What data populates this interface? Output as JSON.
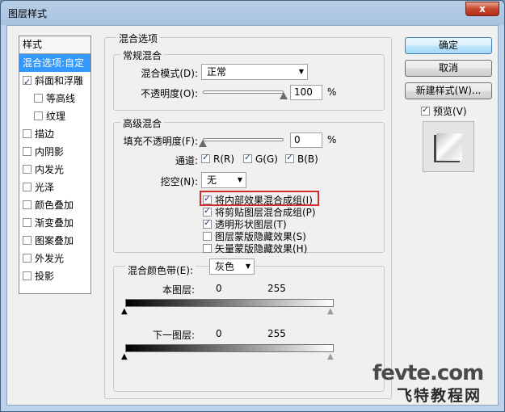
{
  "window": {
    "title": "图层样式",
    "close_glyph": "x"
  },
  "style_list": {
    "header": "样式",
    "items": [
      {
        "label": "混合选项:自定",
        "selected": true,
        "checkbox": false,
        "checked": false,
        "indent": false
      },
      {
        "label": "斜面和浮雕",
        "selected": false,
        "checkbox": true,
        "checked": true,
        "indent": false
      },
      {
        "label": "等高线",
        "selected": false,
        "checkbox": true,
        "checked": false,
        "indent": true
      },
      {
        "label": "纹理",
        "selected": false,
        "checkbox": true,
        "checked": false,
        "indent": true
      },
      {
        "label": "描边",
        "selected": false,
        "checkbox": true,
        "checked": false,
        "indent": false
      },
      {
        "label": "内阴影",
        "selected": false,
        "checkbox": true,
        "checked": false,
        "indent": false
      },
      {
        "label": "内发光",
        "selected": false,
        "checkbox": true,
        "checked": false,
        "indent": false
      },
      {
        "label": "光泽",
        "selected": false,
        "checkbox": true,
        "checked": false,
        "indent": false
      },
      {
        "label": "颜色叠加",
        "selected": false,
        "checkbox": true,
        "checked": false,
        "indent": false
      },
      {
        "label": "渐变叠加",
        "selected": false,
        "checkbox": true,
        "checked": false,
        "indent": false
      },
      {
        "label": "图案叠加",
        "selected": false,
        "checkbox": true,
        "checked": false,
        "indent": false
      },
      {
        "label": "外发光",
        "selected": false,
        "checkbox": true,
        "checked": false,
        "indent": false
      },
      {
        "label": "投影",
        "selected": false,
        "checkbox": true,
        "checked": false,
        "indent": false
      }
    ]
  },
  "blending": {
    "title": "混合选项",
    "general": {
      "title": "常规混合",
      "mode_label": "混合模式(D):",
      "mode_value": "正常",
      "opacity_label": "不透明度(O):",
      "opacity_value": "100",
      "opacity_unit": "%",
      "opacity_level": 1.0
    },
    "advanced": {
      "title": "高级混合",
      "fill_label": "填充不透明度(F):",
      "fill_value": "0",
      "fill_unit": "%",
      "fill_level": 0.0,
      "channels_label": "通道:",
      "channels": [
        {
          "label": "R(R)",
          "checked": true
        },
        {
          "label": "G(G)",
          "checked": true
        },
        {
          "label": "B(B)",
          "checked": true
        }
      ],
      "knockout_label": "挖空(N):",
      "knockout_value": "无",
      "options": [
        {
          "label": "将内部效果混合成组(I)",
          "checked": true,
          "highlighted": true
        },
        {
          "label": "将剪贴图层混合成组(P)",
          "checked": true,
          "highlighted": false
        },
        {
          "label": "透明形状图层(T)",
          "checked": true,
          "highlighted": false
        },
        {
          "label": "图层蒙版隐藏效果(S)",
          "checked": false,
          "highlighted": false
        },
        {
          "label": "矢量蒙版隐藏效果(H)",
          "checked": false,
          "highlighted": false
        }
      ]
    },
    "blend_if": {
      "label": "混合颜色带(E):",
      "value": "灰色",
      "this_layer_label": "本图层:",
      "this_layer_min": "0",
      "this_layer_max": "255",
      "underlying_label": "下一图层:",
      "underlying_min": "0",
      "underlying_max": "255"
    }
  },
  "buttons": {
    "ok": "确定",
    "cancel": "取消",
    "new_style": "新建样式(W)...",
    "preview_label": "预览(V)",
    "preview_checked": true
  },
  "watermark": {
    "line1": "fevte.com",
    "line2": "飞特教程网"
  }
}
